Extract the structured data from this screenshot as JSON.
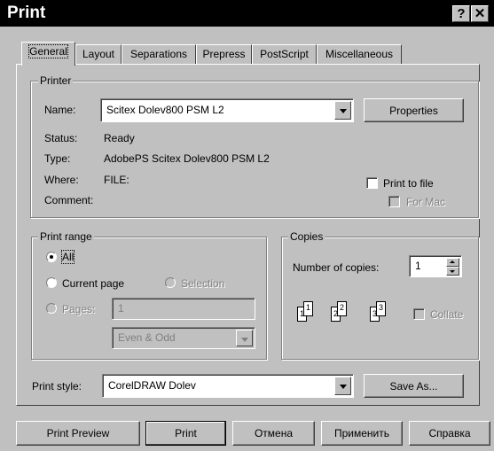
{
  "window": {
    "title": "Print",
    "help_icon": "help-icon",
    "close_icon": "close-icon"
  },
  "tabs": [
    {
      "label": "General",
      "active": true
    },
    {
      "label": "Layout",
      "active": false
    },
    {
      "label": "Separations",
      "active": false
    },
    {
      "label": "Prepress",
      "active": false
    },
    {
      "label": "PostScript",
      "active": false
    },
    {
      "label": "Miscellaneous",
      "active": false
    }
  ],
  "printer": {
    "group_label": "Printer",
    "name_label": "Name:",
    "name_value": "Scitex Dolev800 PSM L2",
    "properties_label": "Properties",
    "status_label": "Status:",
    "status_value": "Ready",
    "type_label": "Type:",
    "type_value": "AdobePS Scitex Dolev800 PSM L2",
    "where_label": "Where:",
    "where_value": "FILE:",
    "comment_label": "Comment:",
    "print_to_file_label": "Print to file",
    "print_to_file_checked": false,
    "for_mac_label": "For Mac",
    "for_mac_checked": false
  },
  "print_range": {
    "group_label": "Print range",
    "all_label": "All",
    "current_page_label": "Current page",
    "selection_label": "Selection",
    "pages_label": "Pages:",
    "pages_value": "1",
    "even_odd_value": "Even & Odd",
    "selected": "All"
  },
  "copies": {
    "group_label": "Copies",
    "number_label": "Number of copies:",
    "number_value": "1",
    "collate_label": "Collate",
    "collate_checked": false,
    "collate_pages": [
      "1",
      "1",
      "2",
      "2",
      "3",
      "3"
    ]
  },
  "print_style": {
    "label": "Print style:",
    "value": "CorelDRAW Dolev",
    "save_as_label": "Save As..."
  },
  "footer": {
    "preview_label": "Print Preview",
    "print_label": "Print",
    "cancel_label": "Отмена",
    "apply_label": "Применить",
    "help_label": "Справка"
  }
}
